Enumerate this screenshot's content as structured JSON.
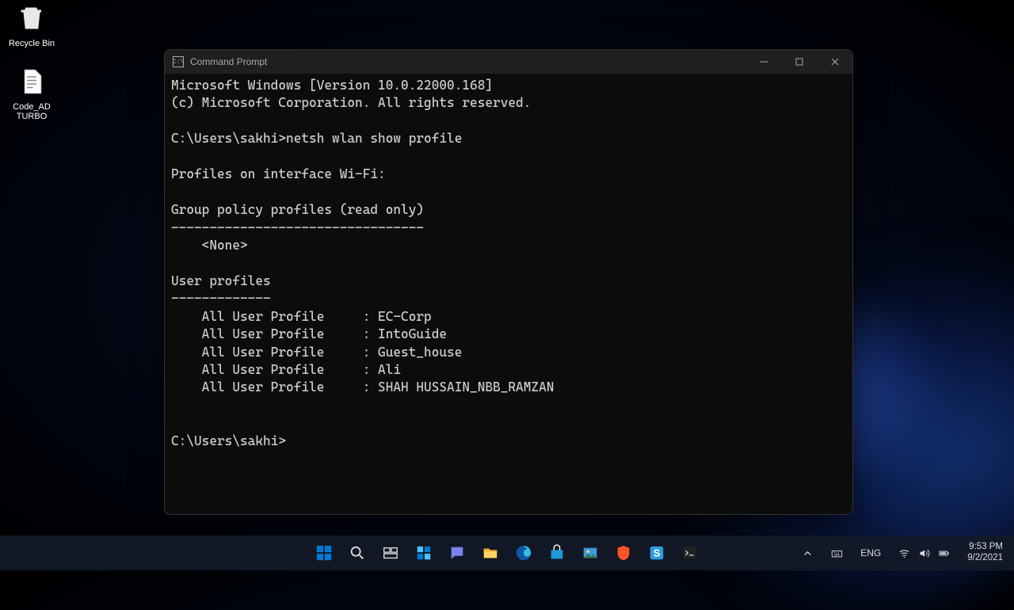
{
  "desktop": {
    "recycle_label": "Recycle Bin",
    "file_label": "Code_AD TURBO"
  },
  "window": {
    "title": "Command Prompt",
    "lines": [
      "Microsoft Windows [Version 10.0.22000.168]",
      "(c) Microsoft Corporation. All rights reserved.",
      "",
      "C:\\Users\\sakhi>netsh wlan show profile",
      "",
      "Profiles on interface Wi-Fi:",
      "",
      "Group policy profiles (read only)",
      "---------------------------------",
      "    <None>",
      "",
      "User profiles",
      "-------------",
      "    All User Profile     : EC-Corp",
      "    All User Profile     : IntoGuide",
      "    All User Profile     : Guest_house",
      "    All User Profile     : Ali",
      "    All User Profile     : SHAH HUSSAIN_NBB_RAMZAN",
      "",
      "",
      "C:\\Users\\sakhi>"
    ]
  },
  "taskbar": {
    "lang": "ENG",
    "time": "9:53 PM",
    "date": "9/2/2021"
  }
}
